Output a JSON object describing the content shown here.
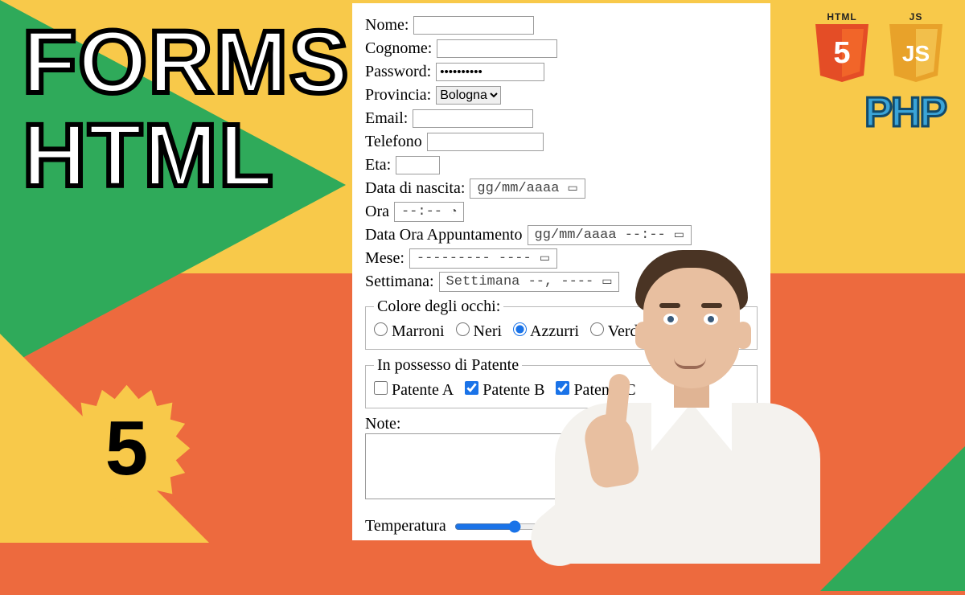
{
  "title": {
    "line1": "FORMS",
    "line2": "HTML"
  },
  "badge_number": "5",
  "logos": {
    "html5_tag": "HTML",
    "html5_num": "5",
    "js_tag": "JS",
    "js_inner": "JS"
  },
  "php_label": "PHP",
  "form": {
    "nome_label": "Nome:",
    "cognome_label": "Cognome:",
    "password_label": "Password:",
    "password_value": "••••••••••",
    "provincia_label": "Provincia:",
    "provincia_value": "Bologna",
    "email_label": "Email:",
    "telefono_label": "Telefono",
    "eta_label": "Eta:",
    "data_nascita_label": "Data di nascita:",
    "data_nascita_placeholder": "gg/mm/aaaa",
    "ora_label": "Ora",
    "ora_placeholder": "--:--",
    "data_ora_label": "Data Ora Appuntamento",
    "data_ora_placeholder": "gg/mm/aaaa --:--",
    "mese_label": "Mese:",
    "mese_placeholder": "--------- ----",
    "settimana_label": "Settimana:",
    "settimana_placeholder": "Settimana --, ----",
    "eyes_legend": "Colore degli occhi:",
    "eyes_options": {
      "opt1": "Marroni",
      "opt2": "Neri",
      "opt3": "Azzurri",
      "opt4": "Verdi"
    },
    "eyes_selected": "Azzurri",
    "patente_legend": "In possesso di Patente",
    "patente_options": {
      "a": "Patente A",
      "b": "Patente B",
      "c": "Patente C"
    },
    "patente_checked": {
      "a": false,
      "b": true,
      "c": true
    },
    "note_label": "Note:",
    "temperatura_label": "Temperatura"
  }
}
